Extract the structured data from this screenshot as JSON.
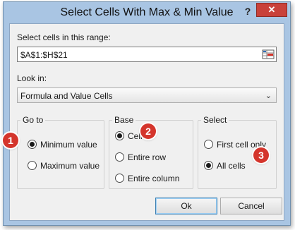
{
  "window": {
    "title": "Select Cells With Max & Min Value",
    "help_label": "?",
    "close_label": "✕"
  },
  "range": {
    "label": "Select cells in this range:",
    "value": "$A$1:$H$21",
    "picker_icon": "range-picker-icon"
  },
  "look_in": {
    "label": "Look in:",
    "selected": "Formula and Value Cells"
  },
  "go_to": {
    "title": "Go to",
    "options": [
      {
        "label": "Minimum value",
        "checked": true
      },
      {
        "label": "Maximum value",
        "checked": false
      }
    ]
  },
  "base": {
    "title": "Base",
    "options": [
      {
        "label": "Cell",
        "checked": true
      },
      {
        "label": "Entire row",
        "checked": false
      },
      {
        "label": "Entire column",
        "checked": false
      }
    ]
  },
  "select": {
    "title": "Select",
    "options": [
      {
        "label": "First cell only",
        "checked": false
      },
      {
        "label": "All cells",
        "checked": true
      }
    ]
  },
  "badges": [
    "1",
    "2",
    "3"
  ],
  "buttons": {
    "ok": "Ok",
    "cancel": "Cancel"
  },
  "colors": {
    "title_bar": "#a9c5e3",
    "close_button": "#c9413a",
    "badge": "#d4352c"
  }
}
